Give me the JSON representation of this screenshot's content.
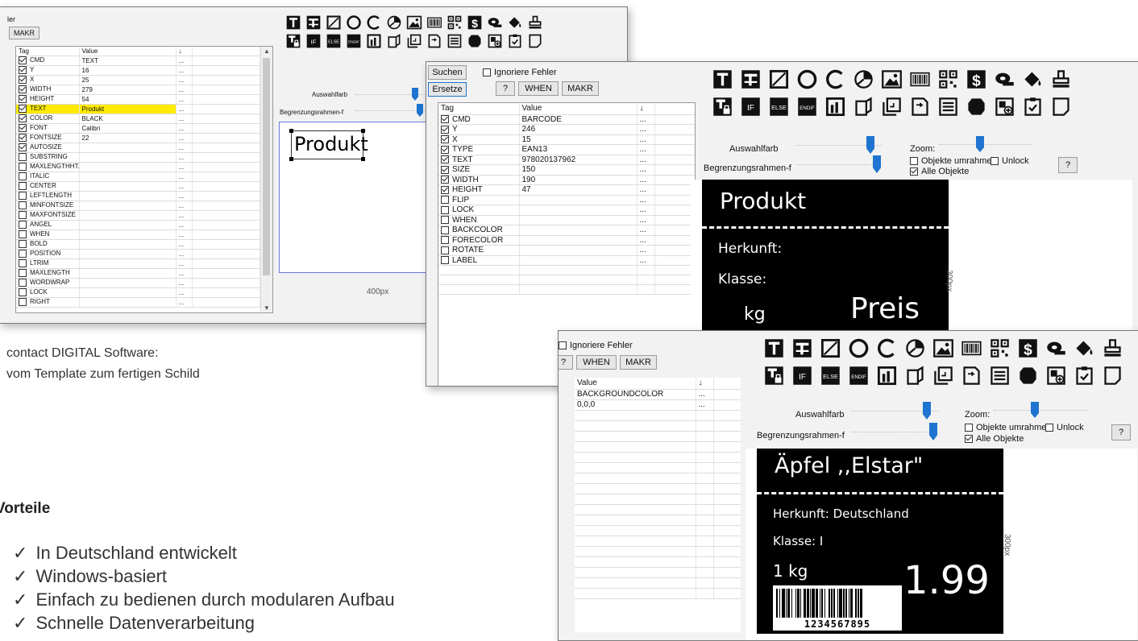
{
  "toolbar_glyphs": [
    "T",
    "IF",
    "ELSE",
    "ENDIF",
    "$"
  ],
  "w1": {
    "title_fragment": "ler",
    "makr": "MAKR",
    "columns": [
      "Tag",
      "Value",
      "↓"
    ],
    "rows": [
      {
        "tag": "CMD",
        "value": "TEXT",
        "on": true
      },
      {
        "tag": "Y",
        "value": "16",
        "on": true
      },
      {
        "tag": "X",
        "value": "25",
        "on": true
      },
      {
        "tag": "WIDTH",
        "value": "279",
        "on": true
      },
      {
        "tag": "HEIGHT",
        "value": "54",
        "on": true
      },
      {
        "tag": "TEXT",
        "value": "Produkt",
        "on": true,
        "hl": true
      },
      {
        "tag": "COLOR",
        "value": "BLACK",
        "on": true
      },
      {
        "tag": "FONT",
        "value": "Calibri",
        "on": true
      },
      {
        "tag": "FONTSIZE",
        "value": "22",
        "on": true
      },
      {
        "tag": "AUTOSIZE",
        "value": "",
        "on": true
      },
      {
        "tag": "SUBSTRING",
        "value": "",
        "on": false
      },
      {
        "tag": "MAXLENGTHHT...",
        "value": "",
        "on": false
      },
      {
        "tag": "ITALIC",
        "value": "",
        "on": false
      },
      {
        "tag": "CENTER",
        "value": "",
        "on": false
      },
      {
        "tag": "LEFTLENGTH",
        "value": "",
        "on": false
      },
      {
        "tag": "MINFONTSIZE",
        "value": "",
        "on": false
      },
      {
        "tag": "MAXFONTSIZE",
        "value": "",
        "on": false
      },
      {
        "tag": "ANGEL",
        "value": "",
        "on": false
      },
      {
        "tag": "WHEN",
        "value": "",
        "on": false
      },
      {
        "tag": "BOLD",
        "value": "",
        "on": false
      },
      {
        "tag": "POSITION",
        "value": "",
        "on": false
      },
      {
        "tag": "LTRIM",
        "value": "",
        "on": false
      },
      {
        "tag": "MAXLENGTH",
        "value": "",
        "on": false
      },
      {
        "tag": "WORDWRAP",
        "value": "",
        "on": false
      },
      {
        "tag": "LOCK",
        "value": "",
        "on": false
      },
      {
        "tag": "RIGHT",
        "value": "",
        "on": false
      }
    ],
    "auswahl": "Auswahlfarb",
    "begrenzung": "Begrenzungsrahmen-f",
    "canvas_text": "Produkt",
    "width_label": "400px"
  },
  "w2": {
    "suchen": "Suchen",
    "ersetze": "Ersetze",
    "ignoriere": "Ignoriere Fehler",
    "q": "?",
    "when": "WHEN",
    "makr": "MAKR",
    "columns": [
      "Tag",
      "Value",
      "↓"
    ],
    "rows": [
      {
        "tag": "CMD",
        "value": "BARCODE",
        "on": true
      },
      {
        "tag": "Y",
        "value": "246",
        "on": true
      },
      {
        "tag": "X",
        "value": "15",
        "on": true
      },
      {
        "tag": "TYPE",
        "value": "EAN13",
        "on": true
      },
      {
        "tag": "TEXT",
        "value": "978020137962",
        "on": true
      },
      {
        "tag": "SIZE",
        "value": "150",
        "on": true
      },
      {
        "tag": "WIDTH",
        "value": "190",
        "on": true
      },
      {
        "tag": "HEIGHT",
        "value": "47",
        "on": true
      },
      {
        "tag": "FLIP",
        "value": "",
        "on": false
      },
      {
        "tag": "LOCK",
        "value": "",
        "on": false
      },
      {
        "tag": "WHEN",
        "value": "",
        "on": false
      },
      {
        "tag": "BACKCOLOR",
        "value": "",
        "on": false
      },
      {
        "tag": "FORECOLOR",
        "value": "",
        "on": false
      },
      {
        "tag": "ROTATE",
        "value": "",
        "on": false
      },
      {
        "tag": "LABEL",
        "value": "",
        "on": false
      }
    ],
    "auswahl": "Auswahlfarb",
    "begrenzung": "Begrenzungsrahmen-f",
    "zoom": "Zoom:",
    "objekte": "Objekte umrahme",
    "unlock": "Unlock",
    "alle": "Alle Objekte",
    "help": "?",
    "label_title": "Produkt",
    "herkunft": "Herkunft:",
    "klasse": "Klasse:",
    "kg": "kg",
    "preis": "Preis",
    "height_label": "300px"
  },
  "w3": {
    "ignoriere": "Ignoriere Fehler",
    "q": "?",
    "when": "WHEN",
    "makr": "MAKR",
    "columns": [
      "Value",
      "↓"
    ],
    "rows": [
      {
        "value": "BACKGROUNDCOLOR"
      },
      {
        "value": "0,0,0"
      }
    ],
    "auswahl": "Auswahlfarb",
    "begrenzung": "Begrenzungsrahmen-f",
    "zoom": "Zoom:",
    "objekte": "Objekte umrahme",
    "unlock": "Unlock",
    "alle": "Alle Objekte",
    "help": "?",
    "label_title": "Äpfel ,,Elstar\"",
    "herkunft": "Herkunft: Deutschland",
    "klasse": "Klasse: I",
    "kg": "1 kg",
    "price": "1.99",
    "barcode_number": "1234567895",
    "height_label": "300px"
  },
  "marketing": {
    "line1": "contact DIGITAL Software:",
    "line2": "vom Template zum fertigen Schild",
    "heading": "Vorteile",
    "checkmark": "✓",
    "bullets": [
      "In Deutschland entwickelt",
      "Windows-basiert",
      "Einfach zu bedienen durch modularen Aufbau",
      "Schnelle Datenverarbeitung"
    ]
  },
  "accent_color": "#1e74d0",
  "highlight_color": "#ffea00"
}
